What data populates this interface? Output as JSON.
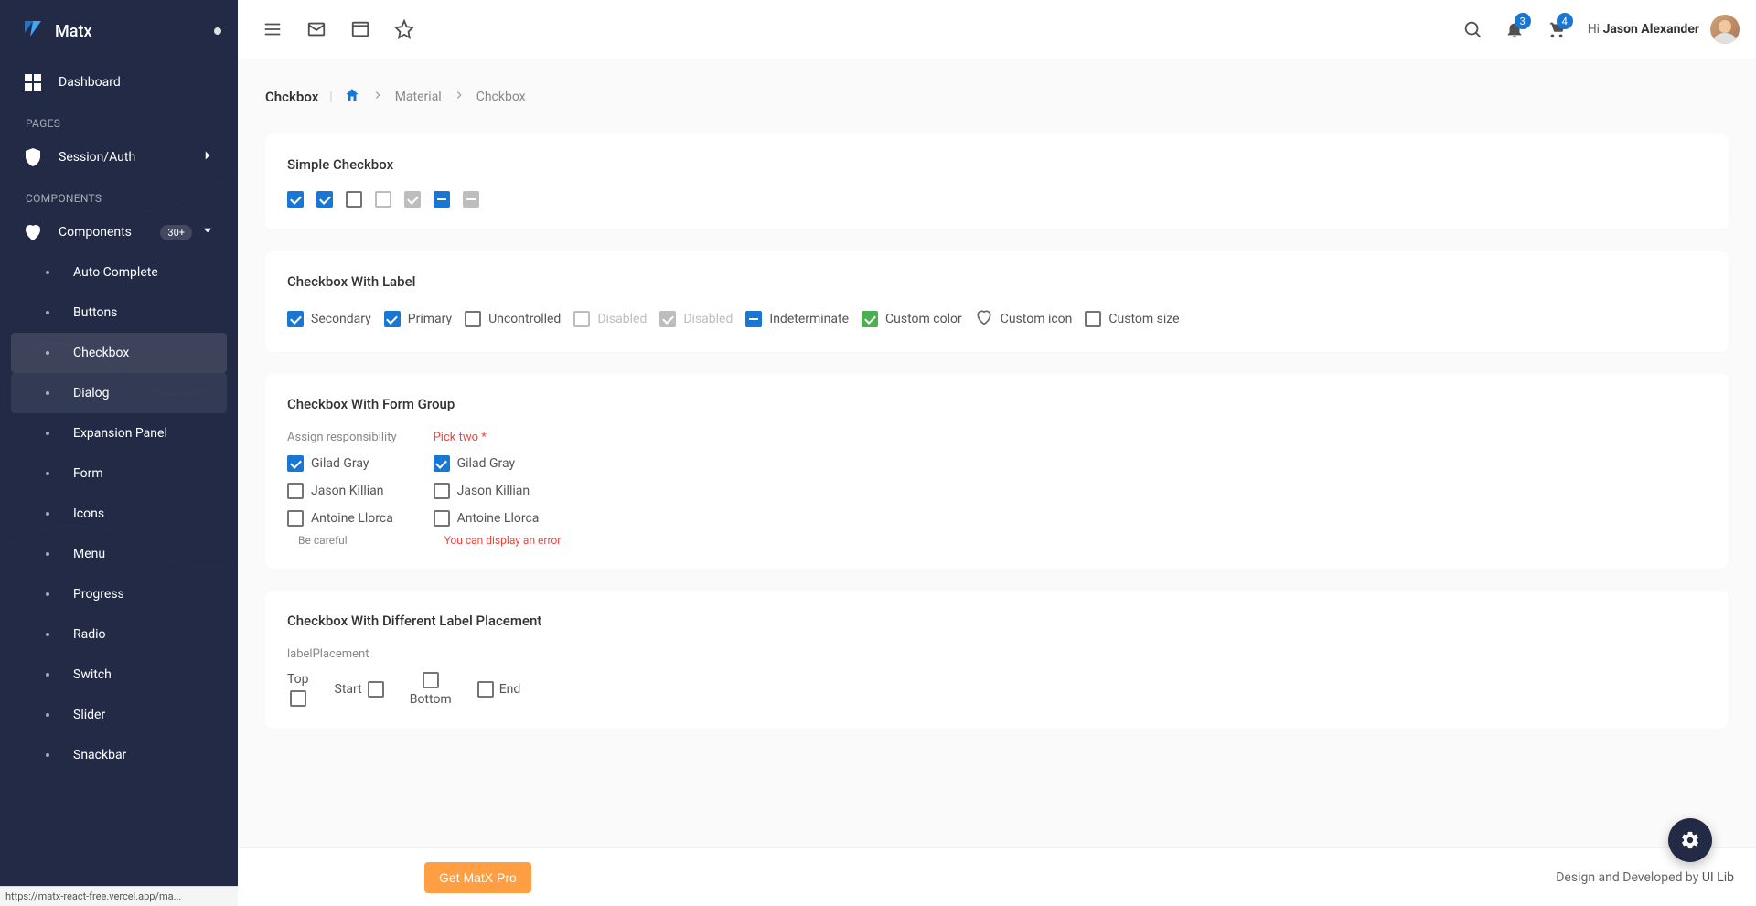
{
  "brand": "Matx",
  "sidebar": {
    "dashboard": "Dashboard",
    "section_pages": "PAGES",
    "session": "Session/Auth",
    "section_components": "COMPONENTS",
    "components_label": "Components",
    "components_badge": "30+",
    "items": [
      "Auto Complete",
      "Buttons",
      "Checkbox",
      "Dialog",
      "Expansion Panel",
      "Form",
      "Icons",
      "Menu",
      "Progress",
      "Radio",
      "Switch",
      "Slider",
      "Snackbar"
    ]
  },
  "topbar": {
    "notif_badge": "3",
    "cart_badge": "4",
    "greet_prefix": "Hi ",
    "user_name": "Jason Alexander"
  },
  "breadcrumb": {
    "title": "Chckbox",
    "material": "Material",
    "current": "Chckbox"
  },
  "cards": {
    "simple": {
      "title": "Simple Checkbox"
    },
    "labeled": {
      "title": "Checkbox With Label",
      "items": [
        "Secondary",
        "Primary",
        "Uncontrolled",
        "Disabled",
        "Disabled",
        "Indeterminate",
        "Custom color",
        "Custom icon",
        "Custom size"
      ]
    },
    "formgroup": {
      "title": "Checkbox With Form Group",
      "legend1": "Assign responsibility",
      "legend2": "Pick two *",
      "options": [
        "Gilad Gray",
        "Jason Killian",
        "Antoine Llorca"
      ],
      "helper1": "Be careful",
      "helper2": "You can display an error"
    },
    "placement": {
      "title": "Checkbox With Different Label Placement",
      "legend": "labelPlacement",
      "labels": [
        "Top",
        "Start",
        "Bottom",
        "End"
      ]
    }
  },
  "footer": {
    "pro": "Get MatX Pro",
    "credit_prefix": "Design and Developed by ",
    "credit_link": "UI Lib"
  },
  "status_url": "https://matx-react-free.vercel.app/ma..."
}
